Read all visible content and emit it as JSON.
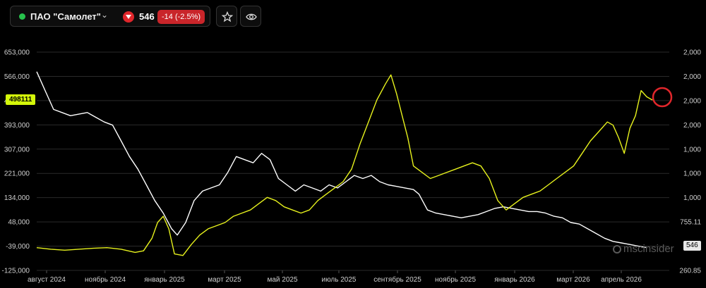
{
  "header": {
    "ticker_name": "ПАО \"Самолет\"",
    "price": "546",
    "change": "-14 (-2.5%)",
    "status_color": "#27c24c",
    "down_color": "#e0262b",
    "star_icon": "star-icon",
    "eye_icon": "eye-icon"
  },
  "badges": {
    "left_value": "498111",
    "right_value": "546",
    "left_color": "#d4f70a"
  },
  "watermark": "mscinsider",
  "chart_data": {
    "type": "line",
    "left_axis": {
      "ticks": [
        "653,000",
        "566,000",
        "480,000",
        "393,000",
        "307,000",
        "221,000",
        "134,000",
        "48,000",
        "-39,000",
        "-125,000"
      ],
      "range": [
        -125000,
        653000
      ]
    },
    "right_axis": {
      "ticks": [
        "2,000",
        "2,000",
        "2,000",
        "2,000",
        "1,000",
        "1,000",
        "1,000",
        "755.11",
        "",
        "260.85"
      ]
    },
    "x_ticks": [
      "август 2024",
      "ноябрь 2024",
      "январь 2025",
      "март 2025",
      "май 2025",
      "июль 2025",
      "сентябрь 2025",
      "ноябрь 2025",
      "январь 2026",
      "март 2026",
      "апрель 2026"
    ],
    "x_range": [
      0,
      22
    ],
    "series": [
      {
        "color": "#ffffff",
        "points": [
          [
            0,
            560
          ],
          [
            0.3,
            500
          ],
          [
            0.6,
            440
          ],
          [
            0.9,
            430
          ],
          [
            1.2,
            420
          ],
          [
            1.5,
            425
          ],
          [
            1.8,
            430
          ],
          [
            2.1,
            415
          ],
          [
            2.4,
            400
          ],
          [
            2.7,
            390
          ],
          [
            3.0,
            340
          ],
          [
            3.3,
            290
          ],
          [
            3.6,
            250
          ],
          [
            3.9,
            200
          ],
          [
            4.2,
            150
          ],
          [
            4.5,
            110
          ],
          [
            4.8,
            60
          ],
          [
            5.0,
            40
          ],
          [
            5.3,
            80
          ],
          [
            5.6,
            150
          ],
          [
            5.9,
            180
          ],
          [
            6.2,
            190
          ],
          [
            6.5,
            200
          ],
          [
            6.8,
            240
          ],
          [
            7.1,
            290
          ],
          [
            7.4,
            280
          ],
          [
            7.7,
            270
          ],
          [
            8.0,
            300
          ],
          [
            8.3,
            280
          ],
          [
            8.6,
            220
          ],
          [
            8.9,
            200
          ],
          [
            9.2,
            180
          ],
          [
            9.5,
            200
          ],
          [
            9.8,
            190
          ],
          [
            10.1,
            180
          ],
          [
            10.4,
            200
          ],
          [
            10.7,
            190
          ],
          [
            11.0,
            210
          ],
          [
            11.3,
            230
          ],
          [
            11.6,
            220
          ],
          [
            11.9,
            230
          ],
          [
            12.2,
            210
          ],
          [
            12.5,
            200
          ],
          [
            12.8,
            195
          ],
          [
            13.1,
            190
          ],
          [
            13.4,
            185
          ],
          [
            13.6,
            170
          ],
          [
            13.9,
            120
          ],
          [
            14.2,
            110
          ],
          [
            14.5,
            105
          ],
          [
            14.8,
            100
          ],
          [
            15.1,
            95
          ],
          [
            15.4,
            100
          ],
          [
            15.7,
            105
          ],
          [
            16.0,
            115
          ],
          [
            16.3,
            125
          ],
          [
            16.6,
            130
          ],
          [
            16.9,
            125
          ],
          [
            17.2,
            120
          ],
          [
            17.5,
            115
          ],
          [
            17.8,
            115
          ],
          [
            18.1,
            110
          ],
          [
            18.4,
            100
          ],
          [
            18.7,
            95
          ],
          [
            19.0,
            80
          ],
          [
            19.3,
            75
          ],
          [
            19.6,
            60
          ],
          [
            19.9,
            45
          ],
          [
            20.2,
            30
          ],
          [
            20.5,
            20
          ],
          [
            20.8,
            15
          ],
          [
            21.1,
            10
          ],
          [
            21.4,
            5
          ],
          [
            21.7,
            0
          ]
        ]
      },
      {
        "color": "#e7f21d",
        "points": [
          [
            0,
            0
          ],
          [
            0.5,
            -5
          ],
          [
            1.0,
            -8
          ],
          [
            1.5,
            -5
          ],
          [
            2.0,
            -2
          ],
          [
            2.5,
            0
          ],
          [
            3.0,
            -5
          ],
          [
            3.5,
            -15
          ],
          [
            3.8,
            -10
          ],
          [
            4.1,
            30
          ],
          [
            4.3,
            80
          ],
          [
            4.5,
            100
          ],
          [
            4.7,
            60
          ],
          [
            4.9,
            -20
          ],
          [
            5.2,
            -25
          ],
          [
            5.5,
            10
          ],
          [
            5.8,
            40
          ],
          [
            6.1,
            60
          ],
          [
            6.4,
            70
          ],
          [
            6.7,
            80
          ],
          [
            7.0,
            100
          ],
          [
            7.3,
            110
          ],
          [
            7.6,
            120
          ],
          [
            7.9,
            140
          ],
          [
            8.2,
            160
          ],
          [
            8.5,
            150
          ],
          [
            8.8,
            130
          ],
          [
            9.1,
            120
          ],
          [
            9.4,
            110
          ],
          [
            9.7,
            120
          ],
          [
            10.0,
            150
          ],
          [
            10.3,
            170
          ],
          [
            10.6,
            190
          ],
          [
            10.9,
            210
          ],
          [
            11.2,
            250
          ],
          [
            11.5,
            330
          ],
          [
            11.8,
            400
          ],
          [
            12.1,
            470
          ],
          [
            12.4,
            520
          ],
          [
            12.6,
            550
          ],
          [
            12.8,
            490
          ],
          [
            13.0,
            420
          ],
          [
            13.2,
            350
          ],
          [
            13.4,
            260
          ],
          [
            13.7,
            240
          ],
          [
            14.0,
            220
          ],
          [
            14.3,
            230
          ],
          [
            14.6,
            240
          ],
          [
            14.9,
            250
          ],
          [
            15.2,
            260
          ],
          [
            15.5,
            270
          ],
          [
            15.8,
            260
          ],
          [
            16.1,
            220
          ],
          [
            16.4,
            150
          ],
          [
            16.7,
            120
          ],
          [
            17.0,
            140
          ],
          [
            17.3,
            160
          ],
          [
            17.6,
            170
          ],
          [
            17.9,
            180
          ],
          [
            18.2,
            200
          ],
          [
            18.5,
            220
          ],
          [
            18.8,
            240
          ],
          [
            19.1,
            260
          ],
          [
            19.4,
            300
          ],
          [
            19.7,
            340
          ],
          [
            20.0,
            370
          ],
          [
            20.3,
            400
          ],
          [
            20.5,
            390
          ],
          [
            20.7,
            350
          ],
          [
            20.9,
            300
          ],
          [
            21.1,
            380
          ],
          [
            21.3,
            420
          ],
          [
            21.5,
            500
          ],
          [
            21.7,
            480
          ],
          [
            21.9,
            470
          ]
        ]
      }
    ],
    "highlight_marker": "circle"
  }
}
